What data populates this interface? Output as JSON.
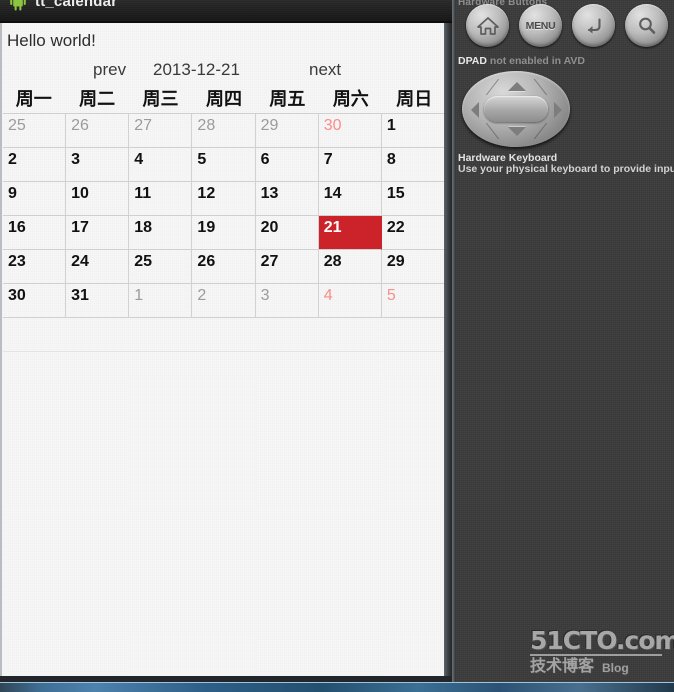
{
  "window": {
    "app_title": "tt_calendar",
    "app_icon": "android-robot-icon"
  },
  "app": {
    "hello_text": "Hello world!",
    "nav": {
      "prev_label": "prev",
      "current_date": "2013-12-21",
      "next_label": "next"
    },
    "weekday_headers": [
      "周一",
      "周二",
      "周三",
      "周四",
      "周五",
      "周六",
      "周日"
    ],
    "selected_day": "21",
    "colors": {
      "selected_bg": "#cc2229",
      "weekend_text": "#ef2222",
      "other_month_text": "#9b9b9b",
      "current_month_text": "#111111",
      "screen_bg": "#f7f7f7"
    },
    "weeks": [
      [
        {
          "day": "25",
          "month": "other",
          "weekend": false,
          "selected": false
        },
        {
          "day": "26",
          "month": "other",
          "weekend": false,
          "selected": false
        },
        {
          "day": "27",
          "month": "other",
          "weekend": false,
          "selected": false
        },
        {
          "day": "28",
          "month": "other",
          "weekend": false,
          "selected": false
        },
        {
          "day": "29",
          "month": "other",
          "weekend": false,
          "selected": false
        },
        {
          "day": "30",
          "month": "other",
          "weekend": true,
          "selected": false
        },
        {
          "day": "1",
          "month": "current",
          "weekend": true,
          "selected": false
        }
      ],
      [
        {
          "day": "2",
          "month": "current",
          "weekend": false,
          "selected": false
        },
        {
          "day": "3",
          "month": "current",
          "weekend": false,
          "selected": false
        },
        {
          "day": "4",
          "month": "current",
          "weekend": false,
          "selected": false
        },
        {
          "day": "5",
          "month": "current",
          "weekend": false,
          "selected": false
        },
        {
          "day": "6",
          "month": "current",
          "weekend": false,
          "selected": false
        },
        {
          "day": "7",
          "month": "current",
          "weekend": true,
          "selected": false
        },
        {
          "day": "8",
          "month": "current",
          "weekend": true,
          "selected": false
        }
      ],
      [
        {
          "day": "9",
          "month": "current",
          "weekend": false,
          "selected": false
        },
        {
          "day": "10",
          "month": "current",
          "weekend": false,
          "selected": false
        },
        {
          "day": "11",
          "month": "current",
          "weekend": false,
          "selected": false
        },
        {
          "day": "12",
          "month": "current",
          "weekend": false,
          "selected": false
        },
        {
          "day": "13",
          "month": "current",
          "weekend": false,
          "selected": false
        },
        {
          "day": "14",
          "month": "current",
          "weekend": true,
          "selected": false
        },
        {
          "day": "15",
          "month": "current",
          "weekend": true,
          "selected": false
        }
      ],
      [
        {
          "day": "16",
          "month": "current",
          "weekend": false,
          "selected": false
        },
        {
          "day": "17",
          "month": "current",
          "weekend": false,
          "selected": false
        },
        {
          "day": "18",
          "month": "current",
          "weekend": false,
          "selected": false
        },
        {
          "day": "19",
          "month": "current",
          "weekend": false,
          "selected": false
        },
        {
          "day": "20",
          "month": "current",
          "weekend": false,
          "selected": false
        },
        {
          "day": "21",
          "month": "current",
          "weekend": true,
          "selected": true
        },
        {
          "day": "22",
          "month": "current",
          "weekend": true,
          "selected": false
        }
      ],
      [
        {
          "day": "23",
          "month": "current",
          "weekend": false,
          "selected": false
        },
        {
          "day": "24",
          "month": "current",
          "weekend": false,
          "selected": false
        },
        {
          "day": "25",
          "month": "current",
          "weekend": false,
          "selected": false
        },
        {
          "day": "26",
          "month": "current",
          "weekend": false,
          "selected": false
        },
        {
          "day": "27",
          "month": "current",
          "weekend": false,
          "selected": false
        },
        {
          "day": "28",
          "month": "current",
          "weekend": true,
          "selected": false
        },
        {
          "day": "29",
          "month": "current",
          "weekend": true,
          "selected": false
        }
      ],
      [
        {
          "day": "30",
          "month": "current",
          "weekend": false,
          "selected": false
        },
        {
          "day": "31",
          "month": "current",
          "weekend": false,
          "selected": false
        },
        {
          "day": "1",
          "month": "other",
          "weekend": false,
          "selected": false
        },
        {
          "day": "2",
          "month": "other",
          "weekend": false,
          "selected": false
        },
        {
          "day": "3",
          "month": "other",
          "weekend": false,
          "selected": false
        },
        {
          "day": "4",
          "month": "other",
          "weekend": true,
          "selected": false
        },
        {
          "day": "5",
          "month": "other",
          "weekend": true,
          "selected": false
        }
      ]
    ]
  },
  "emulator": {
    "hardware_buttons_caption": "Hardware Buttons",
    "buttons": [
      {
        "name": "home-icon",
        "label": ""
      },
      {
        "name": "menu-icon",
        "label": "MENU"
      },
      {
        "name": "back-icon",
        "label": ""
      },
      {
        "name": "search-icon",
        "label": ""
      }
    ],
    "dpad_caption_strong": "DPAD",
    "dpad_caption_rest": " not enabled in AVD",
    "keyboard_caption": "Hardware Keyboard",
    "keyboard_sub": "Use your physical keyboard to provide input"
  },
  "watermark": {
    "main": "51CTO.com",
    "cn": "技术博客",
    "blog": "Blog"
  }
}
